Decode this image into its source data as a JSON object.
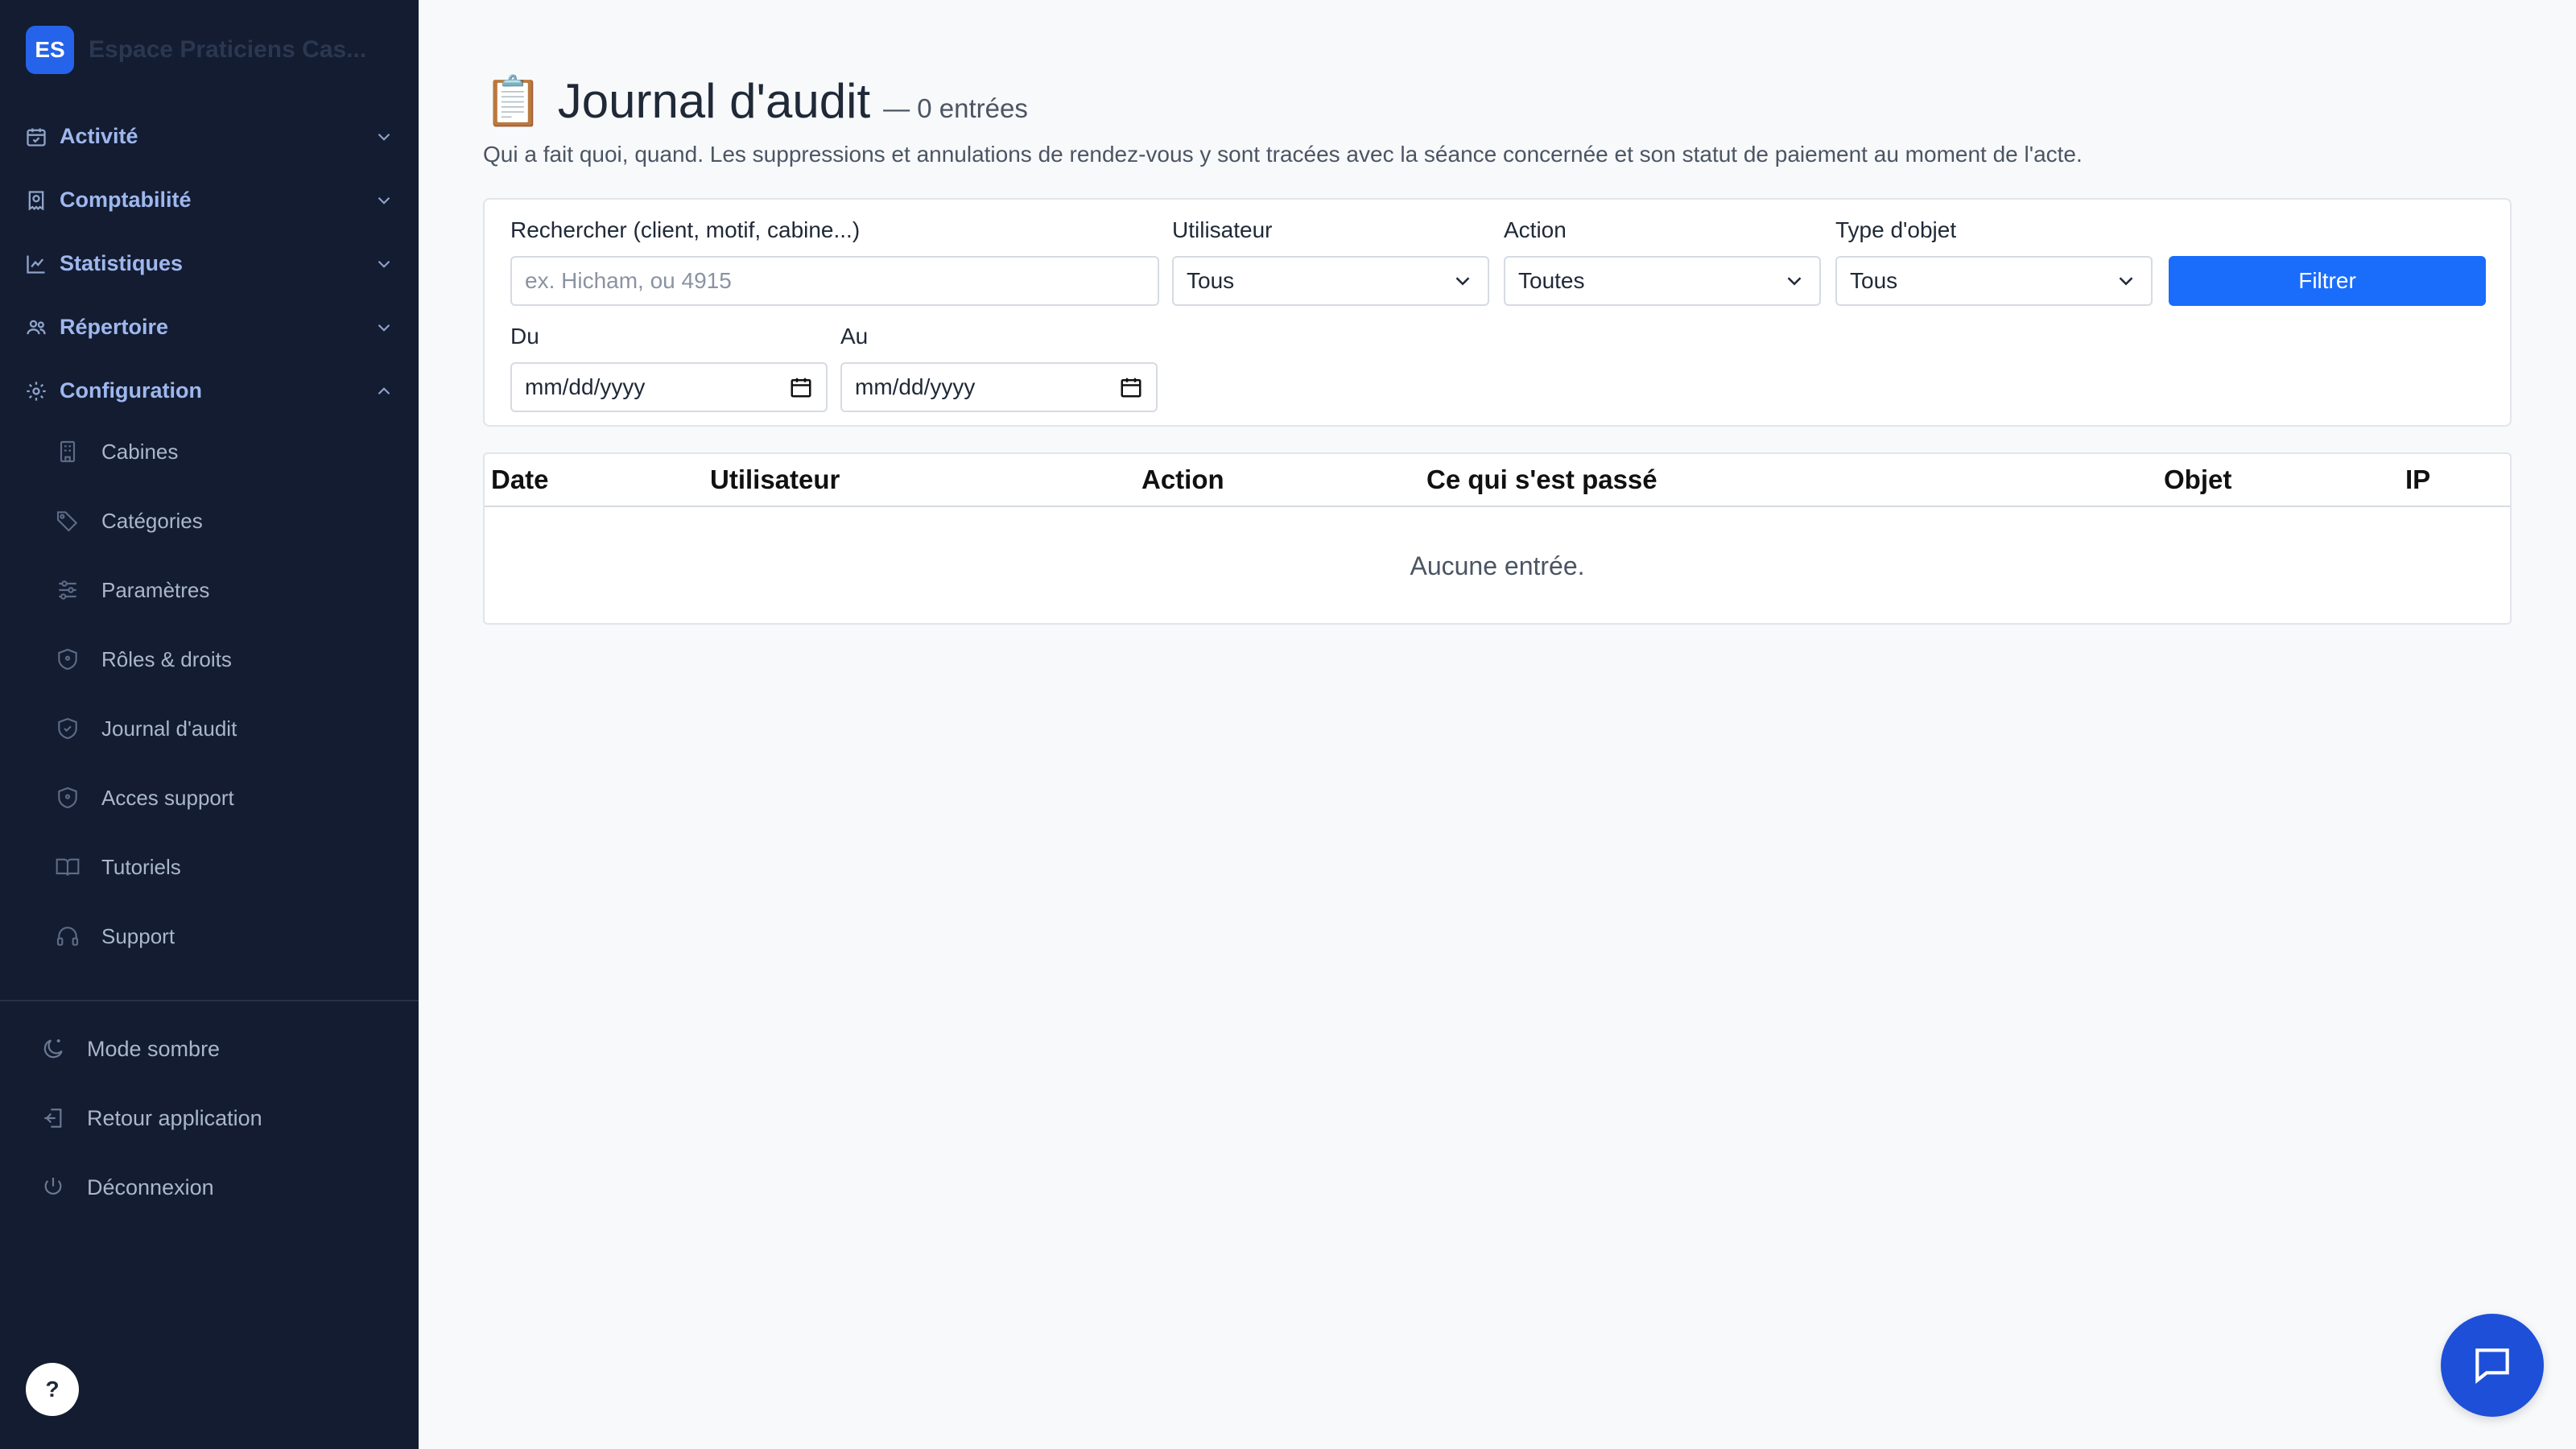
{
  "brand": {
    "initials": "ES",
    "name": "Espace Praticiens Cas..."
  },
  "nav": {
    "sections": [
      {
        "label": "Activité",
        "icon": "calendar-check-icon",
        "expanded": false
      },
      {
        "label": "Comptabilité",
        "icon": "receipt-icon",
        "expanded": false
      },
      {
        "label": "Statistiques",
        "icon": "chart-line-icon",
        "expanded": false
      },
      {
        "label": "Répertoire",
        "icon": "users-icon",
        "expanded": false
      },
      {
        "label": "Configuration",
        "icon": "gear-icon",
        "expanded": true
      }
    ],
    "config_items": [
      {
        "label": "Cabines",
        "icon": "building-icon"
      },
      {
        "label": "Catégories",
        "icon": "tags-icon"
      },
      {
        "label": "Paramètres",
        "icon": "sliders-icon"
      },
      {
        "label": "Rôles & droits",
        "icon": "shield-icon"
      },
      {
        "label": "Journal d'audit",
        "icon": "shield-check-icon"
      },
      {
        "label": "Acces support",
        "icon": "shield-icon"
      },
      {
        "label": "Tutoriels",
        "icon": "book-open-icon"
      },
      {
        "label": "Support",
        "icon": "headset-icon"
      }
    ],
    "bottom_items": [
      {
        "label": "Mode sombre",
        "icon": "moon-icon"
      },
      {
        "label": "Retour application",
        "icon": "log-in-icon"
      },
      {
        "label": "Déconnexion",
        "icon": "power-icon"
      }
    ],
    "help_label": "?"
  },
  "page": {
    "emoji": "📋",
    "title": "Journal d'audit",
    "count": "— 0 entrées",
    "subtitle": "Qui a fait quoi, quand. Les suppressions et annulations de rendez-vous y sont tracées avec la séance concernée et son statut de paiement au moment de l'acte."
  },
  "filters": {
    "search_label": "Rechercher (client, motif, cabine...)",
    "search_placeholder": "ex. Hicham, ou 4915",
    "user_label": "Utilisateur",
    "user_value": "Tous",
    "action_label": "Action",
    "action_value": "Toutes",
    "type_label": "Type d'objet",
    "type_value": "Tous",
    "filter_button": "Filtrer",
    "from_label": "Du",
    "from_value": "mm/dd/yyyy",
    "to_label": "Au",
    "to_value": "mm/dd/yyyy"
  },
  "table": {
    "columns": [
      "Date",
      "Utilisateur",
      "Action",
      "Ce qui s'est passé",
      "Objet",
      "IP"
    ],
    "empty_text": "Aucune entrée."
  },
  "colors": {
    "sidebar_bg": "#131c30",
    "accent": "#1a6dfb",
    "chat_button": "#1d4fd8",
    "page_bg": "#f8f9fb"
  }
}
